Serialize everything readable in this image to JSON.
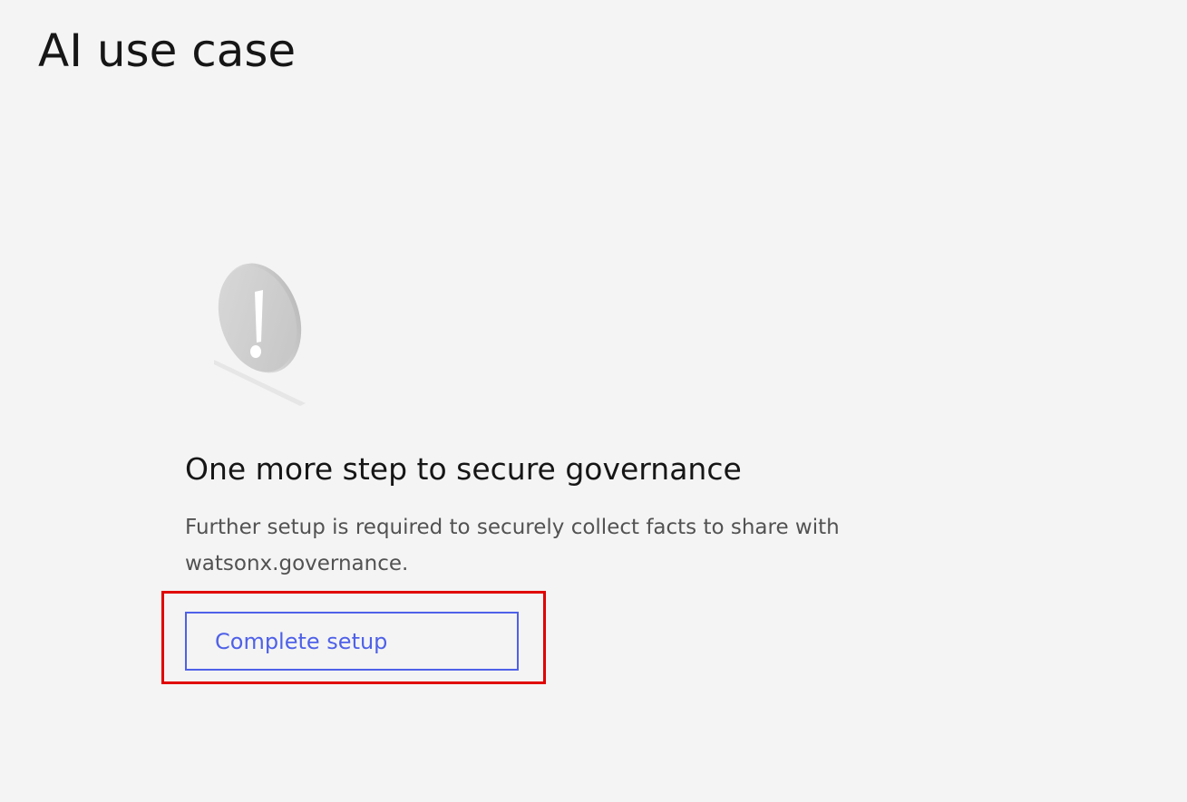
{
  "page": {
    "title": "AI use case"
  },
  "empty_state": {
    "icon": "warning-exclamation-icon",
    "heading": "One more step to secure governance",
    "description": "Further setup is required to securely collect facts to share with watsonx.governance.",
    "button_label": "Complete setup"
  },
  "colors": {
    "background": "#f4f4f4",
    "primary_text": "#161616",
    "secondary_text": "#525252",
    "button_accent": "#4f61e8",
    "highlight_border": "#e00000"
  }
}
